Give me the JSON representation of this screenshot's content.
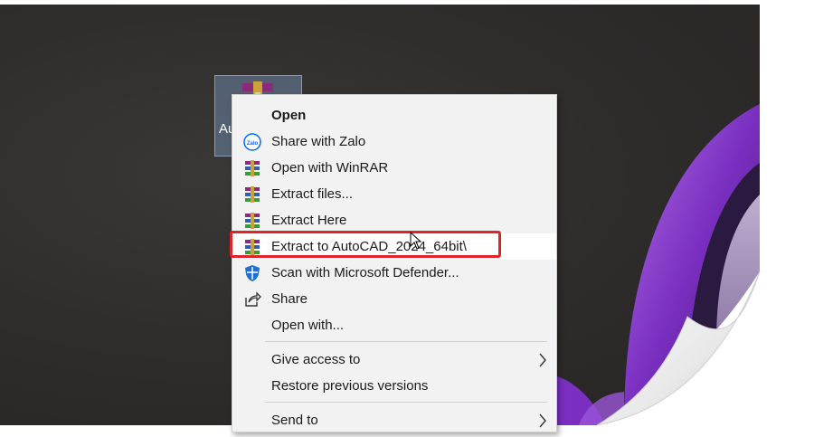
{
  "desktop": {
    "icon_label": "AutoCAD_2024_64bit",
    "icon_name": "winrar-archive-icon"
  },
  "context_menu": {
    "items": [
      {
        "label": "Open",
        "icon": "none",
        "bold": true
      },
      {
        "label": "Share with Zalo",
        "icon": "zalo-icon"
      },
      {
        "label": "Open with WinRAR",
        "icon": "winrar-icon"
      },
      {
        "label": "Extract files...",
        "icon": "winrar-icon"
      },
      {
        "label": "Extract Here",
        "icon": "winrar-icon"
      },
      {
        "label": "Extract to AutoCAD_2024_64bit\\",
        "icon": "winrar-icon",
        "highlighted": true
      },
      {
        "label": "Scan with Microsoft Defender...",
        "icon": "defender-shield-icon"
      },
      {
        "label": "Share",
        "icon": "share-icon"
      },
      {
        "label": "Open with...",
        "icon": "none"
      },
      {
        "label": "Give access to",
        "icon": "none",
        "submenu": true
      },
      {
        "label": "Restore previous versions",
        "icon": "none"
      },
      {
        "label": "Send to",
        "icon": "none",
        "submenu": true
      }
    ]
  },
  "colors": {
    "highlight_box": "#e0242b",
    "menu_background": "#f2f2f2",
    "wallpaper_purple": "#8a3fc9"
  }
}
